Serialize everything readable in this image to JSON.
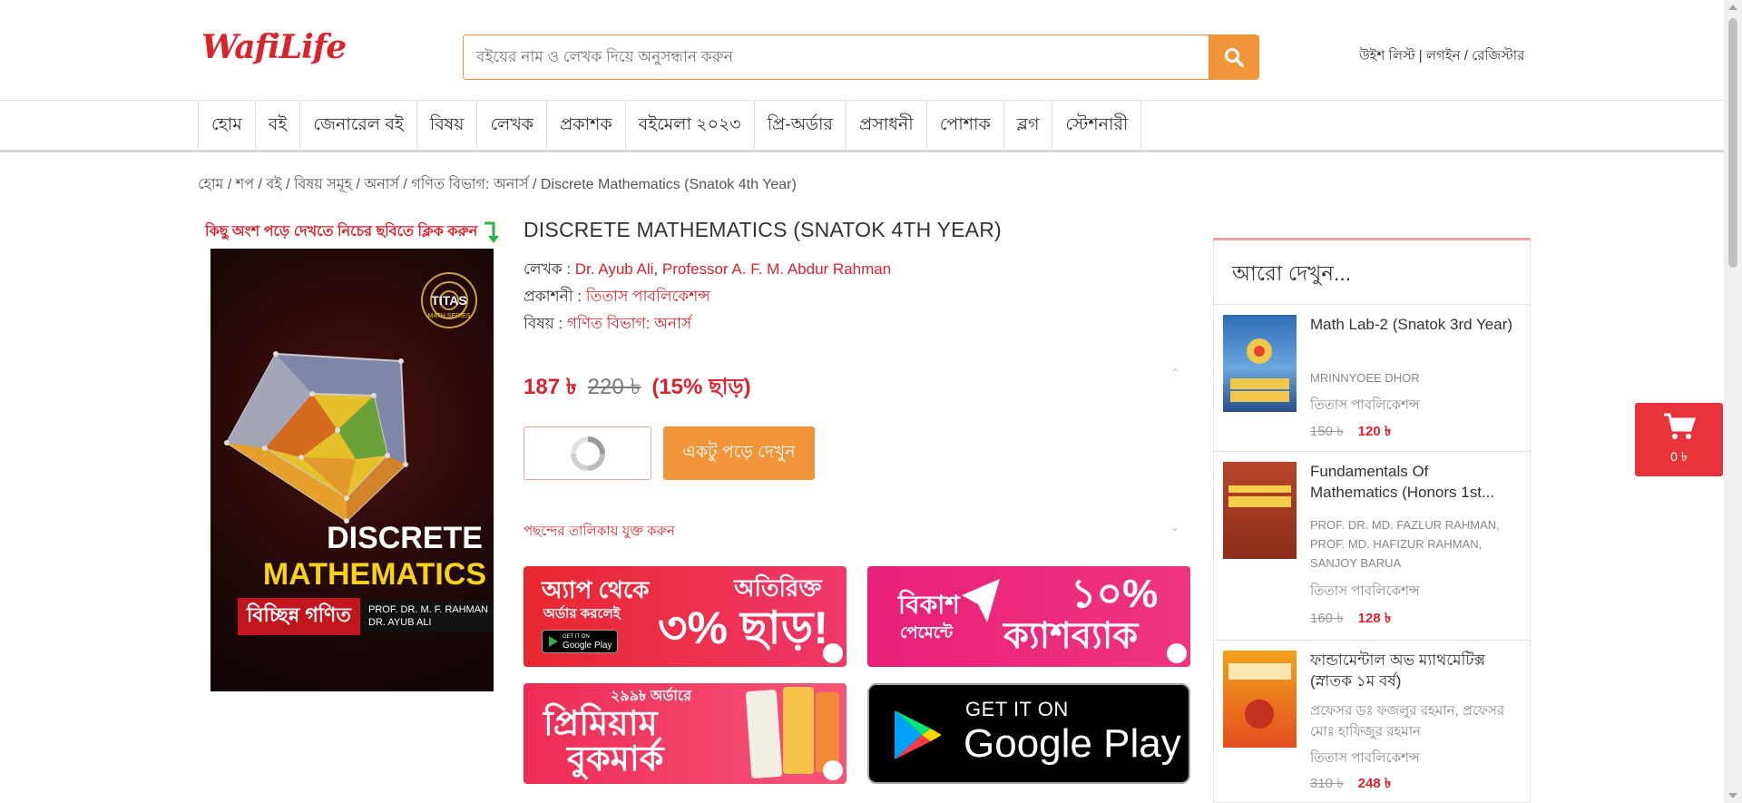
{
  "brand": {
    "logo_text": "WafiLife",
    "primary_color": "#d9232d",
    "accent_color": "#f0953a"
  },
  "search": {
    "placeholder": "বইয়ের নাম ও লেখক দিয়ে অনুসন্ধান করুন",
    "button_icon": "search-icon"
  },
  "header_links": {
    "wishlist": "উইশ লিস্ট",
    "sep1": " | ",
    "login": "লগইন",
    "sep2": " / ",
    "register": "রেজিস্টার"
  },
  "nav": {
    "items": [
      "হোম",
      "বই",
      "জেনারেল বই",
      "বিষয়",
      "লেখক",
      "প্রকাশক",
      "বইমেলা ২০২৩",
      "প্রি-অর্ডার",
      "প্রসাধনী",
      "পোশাক",
      "ব্লগ",
      "স্টেশনারী"
    ]
  },
  "breadcrumb": "হোম / শপ / বই / বিষয় সমূহ / অনার্স / গণিত বিভাগ: অনার্স / Discrete Mathematics (Snatok 4th Year)",
  "cover": {
    "read_hint": "কিছু অংশ পড়ে দেখতে নিচের ছবিতে ক্লিক করুন",
    "series": "TITAS",
    "series_sub": "MATH SERIES",
    "title_line1": "DISCRETE",
    "title_line2": "MATHEMATICS",
    "title_bn": "বিচ্ছিন্ন গণিত",
    "authors_line1": "PROF. DR. M. F. RAHMAN",
    "authors_line2": "DR. AYUB ALI"
  },
  "product": {
    "title": "DISCRETE MATHEMATICS (SNATOK 4TH YEAR)",
    "author_label": "লেখক : ",
    "author1": "Dr. Ayub Ali",
    "author_sep": ", ",
    "author2": "Professor A. F. M. Abdur Rahman",
    "publisher_label": "প্রকাশনী : ",
    "publisher": "তিতাস পাবলিকেশন্স",
    "subject_label": "বিষয় : ",
    "subject": "গণিত বিভাগ: অনার্স",
    "price_now": "187 ৳",
    "price_old": "220 ৳",
    "discount": "(15% ছাড়)",
    "read_button": "একটু পড়ে দেখুন",
    "wishlist_link": "পছন্দের তালিকায় যুক্ত করুন"
  },
  "banners": {
    "app": {
      "line1": "অ্যাপ থেকে",
      "line2": "অর্ডার করলেই",
      "right_top": "অতিরিক্ত",
      "big": "৩% ছাড়!",
      "chip": "Google Play",
      "chip_sub": "GET IT ON"
    },
    "bkash": {
      "line1": "বিকাশ",
      "line2": "পেমেন্টে",
      "big1": "১০%",
      "big2": "ক্যাশব্যাক"
    },
    "bookmark": {
      "small": "২৯৯৳ অর্ডারে",
      "big1": "প্রিমিয়াম",
      "big2": "বুকমার্ক"
    },
    "google_play": {
      "line1": "GET IT ON",
      "line2": "Google Play"
    }
  },
  "sidebar": {
    "title": "আরো দেখুন...",
    "items": [
      {
        "name": "Math Lab-2 (Snatok 3rd Year)",
        "author": "MRINNYOEE DHOR",
        "publisher": "তিতাস পাবলিকেশন্স",
        "price_old": "150 ৳",
        "price_now": "120 ৳"
      },
      {
        "name": "Fundamentals Of Mathematics (Honors 1st...",
        "author": "PROF. DR. MD. FAZLUR RAHMAN, PROF. MD. HAFIZUR RAHMAN, SANJOY BARUA",
        "publisher": "তিতাস পাবলিকেশন্স",
        "price_old": "160 ৳",
        "price_now": "128 ৳"
      },
      {
        "name": "ফান্ডামেন্টাল অভ ম্যাথমেটিক্স (স্নাতক ১ম বর্ষ)",
        "author": "প্রফেসর ডঃ ফজলুর রহমান, প্রফেসর মোঃ হাফিজুর রহমান",
        "publisher": "তিতাস পাবলিকেশন্স",
        "price_old": "310 ৳",
        "price_now": "248 ৳"
      }
    ]
  },
  "cart": {
    "count": "0 ৳"
  }
}
